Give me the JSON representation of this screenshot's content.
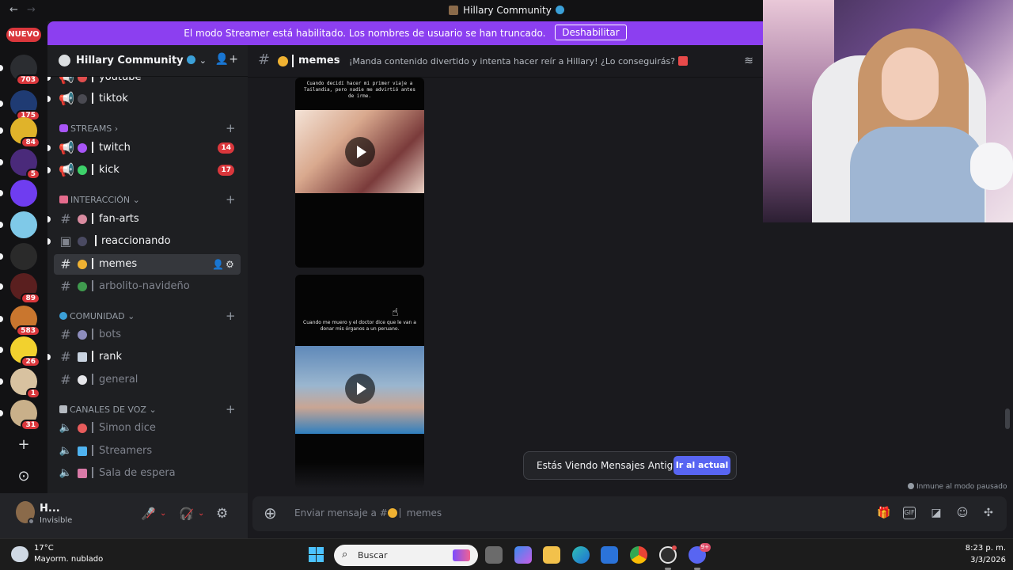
{
  "window": {
    "title": "Hillary Community",
    "nav_back": "←",
    "nav_forward": "→"
  },
  "streamer_mode": {
    "message": "El modo Streamer está habilitado. Los nombres de usuario se han truncado.",
    "disable_label": "Deshabilitar",
    "color": "#8c3ff0"
  },
  "rail": {
    "new_label": "NUEVO",
    "servers": [
      {
        "badge": "703",
        "color": "#2b2d31"
      },
      {
        "badge": "175",
        "color": "#1f3b73"
      },
      {
        "badge": "84",
        "color": "#e0b32a"
      },
      {
        "badge": "5",
        "color": "#4a2a7a"
      },
      {
        "badge": "",
        "color": "#6f3df0"
      },
      {
        "badge": "",
        "color": "#7fc9e8"
      },
      {
        "badge": "",
        "color": "#2a2a2a"
      },
      {
        "badge": "89",
        "color": "#5a1f1f"
      },
      {
        "badge": "583",
        "color": "#c9762e"
      },
      {
        "badge": "26",
        "color": "#f2d12e"
      },
      {
        "badge": "1",
        "color": "#d8c2a0"
      },
      {
        "badge": "31",
        "color": "#c9b08a"
      }
    ],
    "add_icon": "+",
    "discover_icon": "⊙"
  },
  "guild": {
    "name": "Hillary Community"
  },
  "sidebar": {
    "categories": [
      {
        "label": "STREAMS",
        "suffix": "›"
      },
      {
        "label": "INTERACCIÓN",
        "suffix": "⌄"
      },
      {
        "label": "COMUNIDAD",
        "suffix": "⌄"
      },
      {
        "label": "CANALES DE VOZ",
        "suffix": "⌄"
      }
    ],
    "channels": {
      "youtube": {
        "name": "youtube"
      },
      "tiktok": {
        "name": "tiktok"
      },
      "twitch": {
        "name": "twitch",
        "count": "14"
      },
      "kick": {
        "name": "kick",
        "count": "17"
      },
      "fanarts": {
        "name": "fan-arts"
      },
      "reaccionando": {
        "name": "reaccionando"
      },
      "memes": {
        "name": "memes"
      },
      "arbolito": {
        "name": "arbolito-navideño"
      },
      "bots": {
        "name": "bots"
      },
      "rank": {
        "name": "rank"
      },
      "general": {
        "name": "general"
      },
      "simon": {
        "name": "Simon dice"
      },
      "streamers": {
        "name": "Streamers"
      },
      "espera": {
        "name": "Sala de espera"
      }
    }
  },
  "user": {
    "name": "H...",
    "status": "Invisible"
  },
  "chat": {
    "channel": "memes",
    "topic": "¡Manda contenido divertido y intenta hacer reír a Hillary! ¿Lo conseguirás?",
    "videos": [
      {
        "caption": "Cuando decidí hacer mi primer viaje a Tailandia, pero nadie me advirtió antes de irme."
      },
      {
        "caption": "Cuando me muero y el doctor dice que le van a donar mis órganos a un peruano."
      }
    ],
    "old_messages_notice": "Estás Viendo Mensajes Antiguos",
    "jump_label": "Ir al actual",
    "slowmode_note": "Inmune al modo pausado",
    "composer_placeholder": "Enviar mensaje a #",
    "composer_channel": "memes"
  },
  "taskbar": {
    "temperature": "17°C",
    "weather": "Mayorm. nublado",
    "search_label": "Buscar",
    "discord_badge": "9+",
    "time": "8:23 p. m.",
    "date": "3/3/2026"
  },
  "colors": {
    "accent": "#5865f2",
    "danger": "#da373c",
    "background": "#1a1a1e",
    "sidebar": "#1e1f22"
  }
}
